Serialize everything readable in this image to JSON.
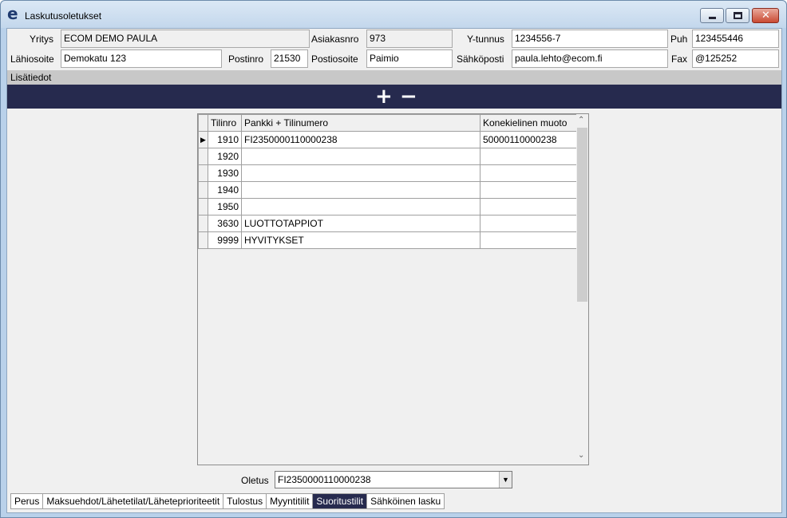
{
  "window": {
    "title": "Laskutusoletukset",
    "icon": "e-logo-icon"
  },
  "form": {
    "yritys": {
      "label": "Yritys",
      "value": "ECOM DEMO PAULA"
    },
    "asiakasnro": {
      "label": "Asiakasnro",
      "value": "973"
    },
    "ytunnus": {
      "label": "Y-tunnus",
      "value": "1234556-7"
    },
    "puh": {
      "label": "Puh",
      "value": "123455446"
    },
    "lahiosoite": {
      "label": "Lähiosoite",
      "value": "Demokatu 123"
    },
    "postinro": {
      "label": "Postinro",
      "value": "21530"
    },
    "postiosoite": {
      "label": "Postiosoite",
      "value": "Paimio"
    },
    "sahkoposti": {
      "label": "Sähköposti",
      "value": "paula.lehto@ecom.fi"
    },
    "fax": {
      "label": "Fax",
      "value": "@125252"
    }
  },
  "section": {
    "label": "Lisätiedot"
  },
  "toolbar": {
    "add": "+",
    "remove": "−"
  },
  "grid": {
    "columns": [
      "Tilinro",
      "Pankki + Tilinumero",
      "Konekielinen muoto"
    ],
    "rows": [
      {
        "tilinro": "1910",
        "pankki": "FI2350000110000238",
        "konekielinen": "50000110000238"
      },
      {
        "tilinro": "1920",
        "pankki": "",
        "konekielinen": ""
      },
      {
        "tilinro": "1930",
        "pankki": "",
        "konekielinen": ""
      },
      {
        "tilinro": "1940",
        "pankki": "",
        "konekielinen": ""
      },
      {
        "tilinro": "1950",
        "pankki": "",
        "konekielinen": ""
      },
      {
        "tilinro": "3630",
        "pankki": "LUOTTOTAPPIOT",
        "konekielinen": ""
      },
      {
        "tilinro": "9999",
        "pankki": "HYVITYKSET",
        "konekielinen": ""
      }
    ],
    "current_row_marker": "▶"
  },
  "oletus": {
    "label": "Oletus",
    "value": "FI2350000110000238"
  },
  "tabs": [
    {
      "label": "Perus",
      "active": false
    },
    {
      "label": "Maksuehdot/Lähetetilat/Läheteprioriteetit",
      "active": false
    },
    {
      "label": "Tulostus",
      "active": false
    },
    {
      "label": "Myyntitilit",
      "active": false
    },
    {
      "label": "Suoritustilit",
      "active": true
    },
    {
      "label": "Sähköinen lasku",
      "active": false
    }
  ],
  "colors": {
    "accent": "#262a4e",
    "section": "#c8c8c8"
  }
}
